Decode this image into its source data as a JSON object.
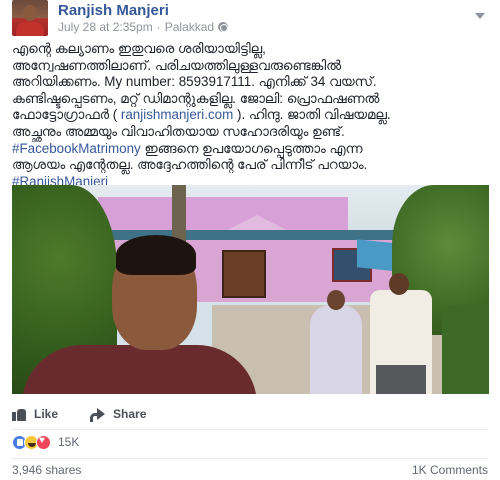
{
  "post": {
    "author": "Ranjish Manjeri",
    "timestamp": "July 28 at 2:35pm",
    "separator": "·",
    "location": "Palakkad",
    "privacy_icon": "globe-icon",
    "menu_icon": "chevron-down-icon"
  },
  "text": {
    "line1": "എന്റെ കല്യാണം ഇതുവരെ ശരിയായിട്ടില്ല,",
    "line2": "അന്വേഷണത്തിലാണ്. പരിചയത്തിലുള്ളവരുണ്ടെങ്കിൽ",
    "line3": "അറിയിക്കണം. My number: 8593917111. എനിക്ക് 34 വയസ്.",
    "line4": "കണ്ടിഷ്ടപ്പെടണം, മറ്റ് ഡിമാന്റുകളില്ല. ജോലി: പ്രൊഫഷണൽ",
    "line5a": "ഫോട്ടോഗ്രാഫർ ( ",
    "line5_link": "ranjishmanjeri.com",
    "line5b": " ). ഹിന്ദു. ജാതി വിഷയമല്ല.",
    "line6": "അച്ഛനും അമ്മയും വിവാഹിതയായ സഹോദരിയും ഉണ്ട്.",
    "line7_hashtag": "#FacebookMatrimony",
    "line7b": " ഇങ്ങനെ ഉപയോഗപ്പെടുത്താം എന്ന",
    "line8": "ആശയം എന്റേതല്ല. അദ്ദേഹത്തിന്റെ പേര് പിന്നീട് പറയാം.",
    "line9_hashtag": "#RanjishManjeri"
  },
  "actions": {
    "like_label": "Like",
    "share_label": "Share"
  },
  "reactions": {
    "count": "15K",
    "types": [
      "like",
      "haha",
      "love"
    ]
  },
  "footer": {
    "shares": "3,946 shares",
    "comments": "1K Comments"
  },
  "colors": {
    "link": "#365899",
    "text": "#1d2129",
    "meta": "#90949c",
    "like_blue": "#4a7de1",
    "love_red": "#f0465a",
    "haha_yellow": "#f7c83b"
  }
}
